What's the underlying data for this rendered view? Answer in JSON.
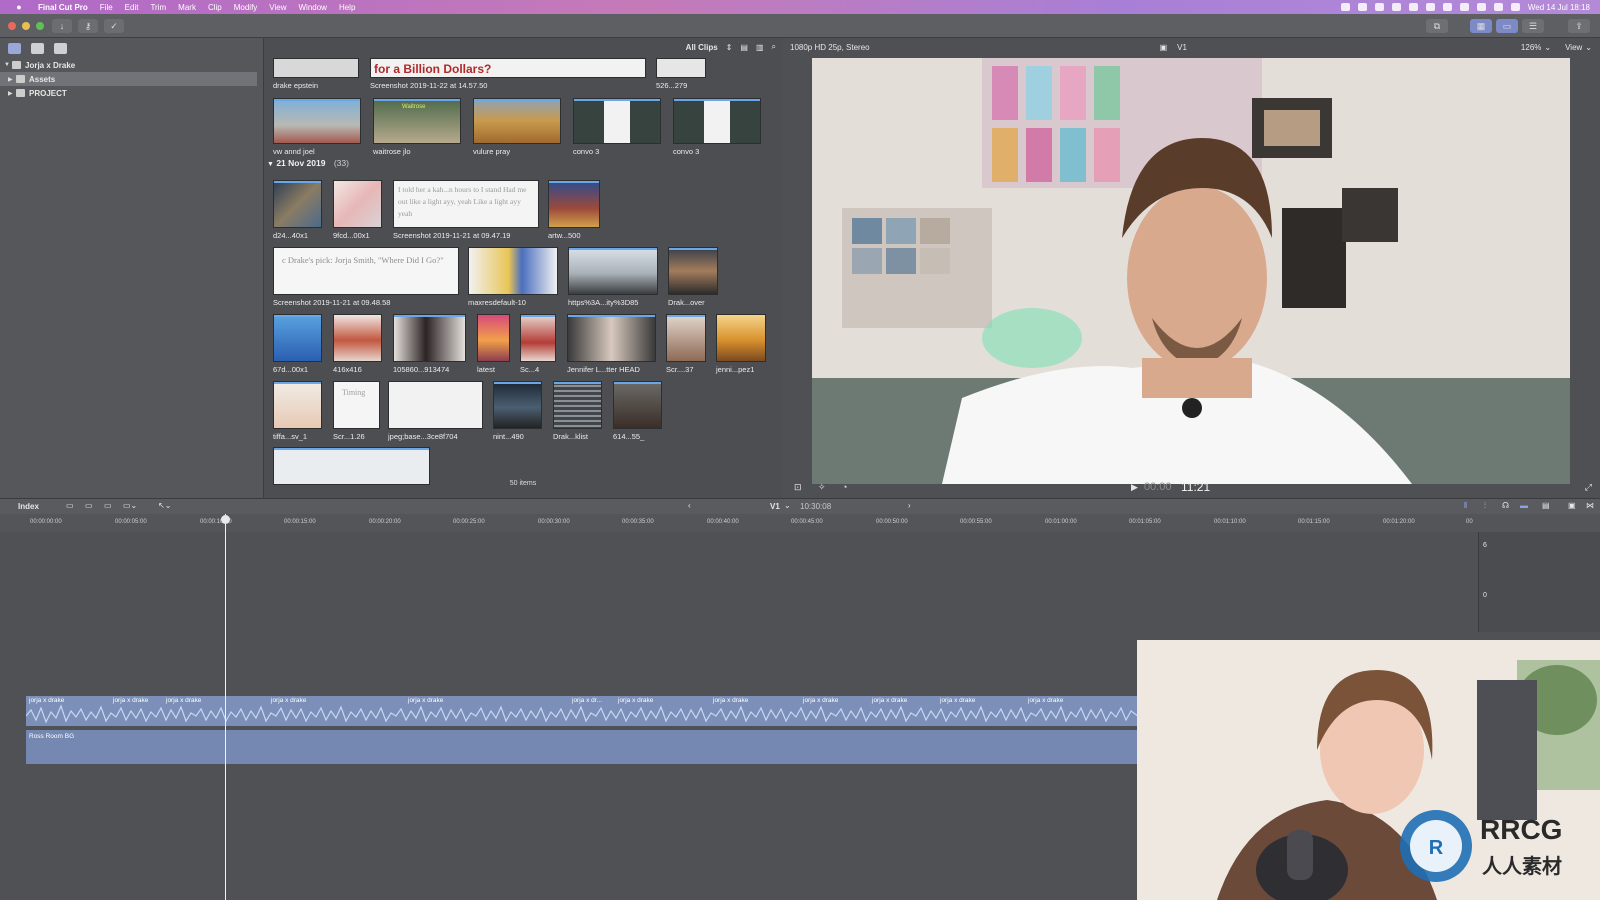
{
  "menubar": {
    "app": "Final Cut Pro",
    "items": [
      "File",
      "Edit",
      "Trim",
      "Mark",
      "Clip",
      "Modify",
      "View",
      "Window",
      "Help"
    ],
    "clock": "Wed 14 Jul 18:18"
  },
  "library": {
    "title": "Jorja x Drake",
    "items": [
      "Assets",
      "PROJECT"
    ]
  },
  "browser": {
    "filter": "All Clips",
    "top_clips": [
      {
        "label": "drake epstein"
      },
      {
        "label": "Screenshot 2019-11-22 at 14.57.50",
        "text": "for a Billion Dollars?"
      },
      {
        "label": "526...279"
      }
    ],
    "row1": [
      {
        "label": "vw annd joel"
      },
      {
        "label": "waitrose jlo",
        "text": "Waitrose"
      },
      {
        "label": "vulure pray"
      },
      {
        "label": "convo 3"
      },
      {
        "label": "convo 3"
      }
    ],
    "group": {
      "date": "21 Nov 2019",
      "count": "(33)"
    },
    "row2": [
      {
        "label": "d24...40x1"
      },
      {
        "label": "9fcd...00x1"
      },
      {
        "label": "Screenshot 2019-11-21 at 09.47.19",
        "text": "I told her a kah...n hours to I stand Had me out like a light ayy, yeah Like a light ayy yeah"
      },
      {
        "label": "artw...500"
      }
    ],
    "row3": [
      {
        "label": "Screenshot 2019-11-21 at 09.48.58",
        "text": "c Drake's pick: Jorja Smith, \"Where Did I Go?\""
      },
      {
        "label": "maxresdefault-10"
      },
      {
        "label": "https%3A...ity%3D85"
      },
      {
        "label": "Drak...over"
      }
    ],
    "row4": [
      {
        "label": "67d...00x1"
      },
      {
        "label": "416x416"
      },
      {
        "label": "105860...913474"
      },
      {
        "label": "latest"
      },
      {
        "label": "Sc...4"
      },
      {
        "label": "Jennifer L...tter HEAD"
      },
      {
        "label": "Scr....37"
      },
      {
        "label": "jenni...pez1"
      }
    ],
    "row5": [
      {
        "label": "tiffa...sv_1"
      },
      {
        "label": "Scr...1.26",
        "text": "Timing"
      },
      {
        "label": "jpeg;base...3ce8f704"
      },
      {
        "label": "nint...490"
      },
      {
        "label": "Drak...klist"
      },
      {
        "label": "614...55_"
      }
    ],
    "items_count": "50 items"
  },
  "viewer": {
    "format": "1080p HD 25p, Stereo",
    "role": "V1",
    "zoom": "126%",
    "view": "View",
    "timecode_dim": "00:00",
    "timecode": "11:21"
  },
  "timeline": {
    "index_label": "Index",
    "role": "V1",
    "duration": "10:30:08",
    "ruler": [
      "00:00:00:00",
      "00:00:05:00",
      "00:00:10:00",
      "00:00:15:00",
      "00:00:20:00",
      "00:00:25:00",
      "00:00:30:00",
      "00:00:35:00",
      "00:00:40:00",
      "00:00:45:00",
      "00:00:50:00",
      "00:00:55:00",
      "00:01:00:00",
      "00:01:05:00",
      "00:01:10:00",
      "00:01:15:00",
      "00:01:20:00",
      "00"
    ],
    "audio_clips": [
      "jorja x drake",
      "jorja x drake",
      "jorja x drake",
      "jorja x drake",
      "jorja x drake",
      "jorja x dr...",
      "jorja x drake",
      "jorja x drake",
      "jorja x drake",
      "jorja x drake",
      "jorja x drake",
      "jorja x drake"
    ],
    "bg_clip": "Ross Room BG",
    "meter_labels": [
      "6",
      "0"
    ]
  },
  "watermark": {
    "brand": "RRCG",
    "cn": "人人素材"
  }
}
